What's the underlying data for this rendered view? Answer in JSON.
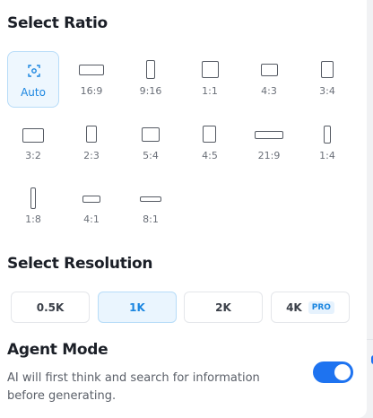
{
  "ratio_section": {
    "title": "Select Ratio",
    "items": [
      {
        "label": "Auto",
        "selected": true,
        "icon": "auto-frame-icon"
      },
      {
        "label": "16:9"
      },
      {
        "label": "9:16"
      },
      {
        "label": "1:1"
      },
      {
        "label": "4:3"
      },
      {
        "label": "3:4"
      },
      {
        "label": "3:2"
      },
      {
        "label": "2:3"
      },
      {
        "label": "5:4"
      },
      {
        "label": "4:5"
      },
      {
        "label": "21:9"
      },
      {
        "label": "1:4"
      },
      {
        "label": "1:8"
      },
      {
        "label": "4:1"
      },
      {
        "label": "8:1"
      }
    ]
  },
  "resolution_section": {
    "title": "Select Resolution",
    "options": [
      {
        "label": "0.5K"
      },
      {
        "label": "1K",
        "selected": true
      },
      {
        "label": "2K"
      },
      {
        "label": "4K",
        "badge": "PRO"
      }
    ]
  },
  "agent_mode": {
    "title": "Agent Mode",
    "description": "AI will first think and search for information before generating.",
    "enabled": true
  },
  "colors": {
    "accent": "#1e73f0",
    "selected_bg": "#eef7fe",
    "selected_text": "#1b86e0"
  }
}
